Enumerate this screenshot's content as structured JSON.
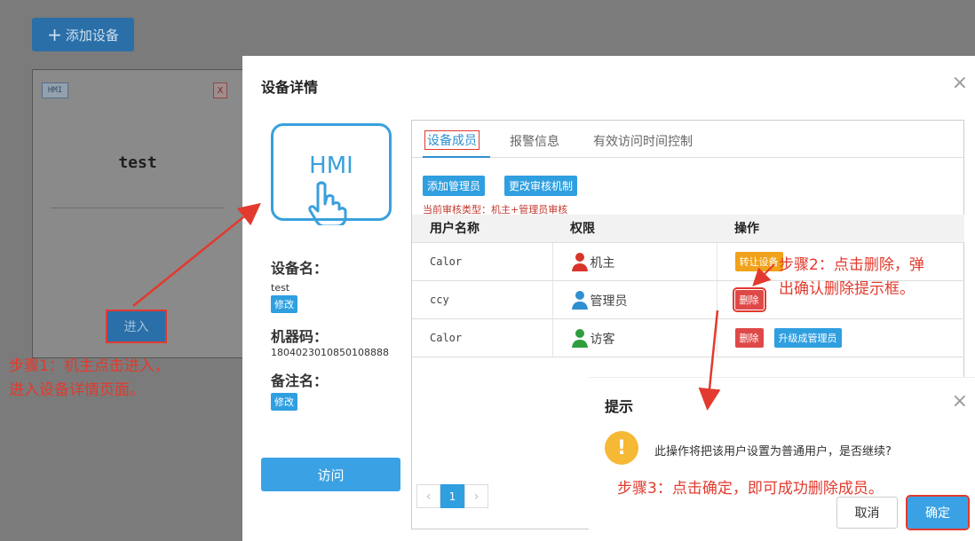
{
  "background": {
    "add_device": "添加设备",
    "card": {
      "tag": "HMI",
      "delete_tag": "X",
      "device_name": "test",
      "enter_button": "进入"
    }
  },
  "annotations": {
    "step1_line1": "步骤1：机主点击进入，",
    "step1_line2": "进入设备详情页面。",
    "step2_line1": "步骤2：点击删除，弹",
    "step2_line2": "出确认删除提示框。",
    "step3": "步骤3：点击确定，即可成功删除成员。",
    "color": "#e23a2e"
  },
  "dialog": {
    "title": "设备详情",
    "close": "×",
    "logo_text": "HMI",
    "device_name_label": "设备名：",
    "device_name_value": "test",
    "edit_label": "修改",
    "machine_code_label": "机器码：",
    "machine_code_value": "1804023010850108888",
    "remark_label": "备注名：",
    "visit_button": "访问",
    "tabs": [
      "设备成员",
      "报警信息",
      "有效访问时间控制"
    ],
    "add_admin_button": "添加管理员",
    "change_audit_button": "更改审核机制",
    "audit_type": "当前审核类型：机主+管理员审核",
    "table": {
      "headers": [
        "用户名称",
        "权限",
        "操作"
      ],
      "rows": [
        {
          "name": "Calor",
          "role": "机主",
          "icon_color": "#d9342b",
          "ops": [
            "转让设备"
          ]
        },
        {
          "name": "ccy",
          "role": "管理员",
          "icon_color": "#2f8fd0",
          "ops": [
            "删除"
          ]
        },
        {
          "name": "Calor",
          "role": "访客",
          "icon_color": "#2e9e3e",
          "ops": [
            "删除",
            "升级成管理员"
          ]
        }
      ]
    },
    "pager": {
      "prev": "‹",
      "page": "1",
      "next": "›"
    }
  },
  "confirm": {
    "title": "提示",
    "close": "×",
    "icon": "!",
    "message": "此操作将把该用户设置为普通用户，是否继续?",
    "cancel": "取消",
    "ok": "确定"
  }
}
